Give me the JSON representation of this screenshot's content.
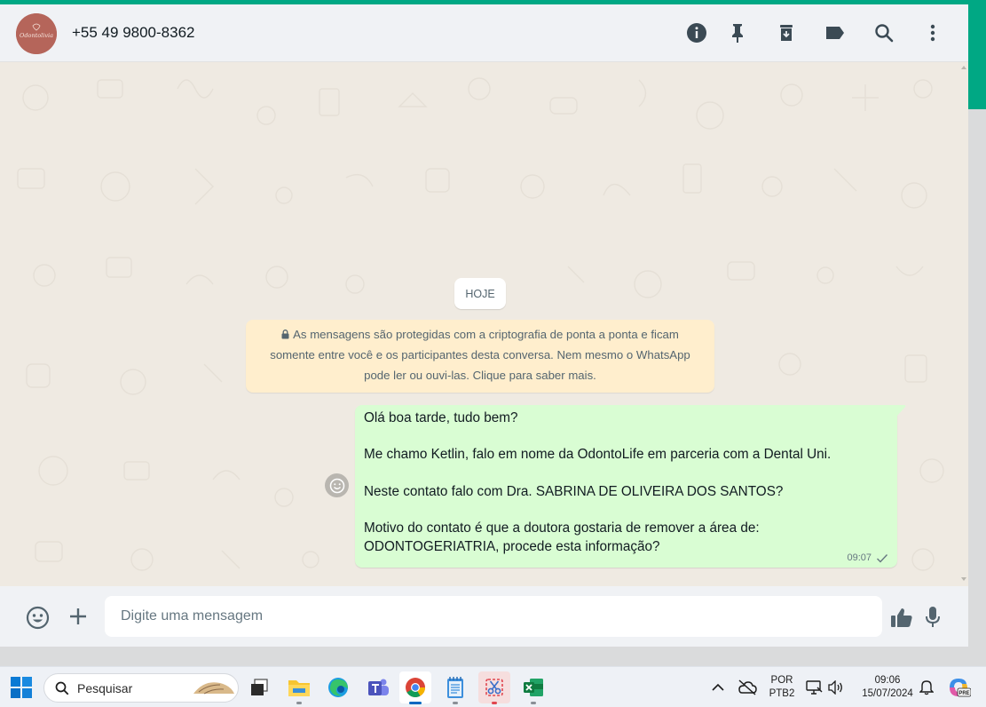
{
  "header": {
    "avatar_text": "Odontolivia",
    "contact_name": "+55 49 9800-8362"
  },
  "chat": {
    "date_chip": "HOJE",
    "encryption_notice": [
      "As mensagens são protegidas com a criptografia de ponta a ponta e ficam",
      "somente entre você e os participantes desta conversa. Nem mesmo o WhatsApp",
      "pode ler ou ouvi-las. Clique para saber mais."
    ],
    "message": {
      "lines": [
        "Olá boa tarde, tudo bem?",
        "",
        "Me chamo Ketlin, falo em nome da OdontoLife em parceria com a Dental Uni.",
        "",
        "Neste contato falo com Dra. SABRINA DE OLIVEIRA DOS SANTOS?",
        "",
        "Motivo do contato é que a doutora gostaria de remover a área de:",
        "ODONTOGERIATRIA, procede esta informação?"
      ],
      "time": "09:07",
      "status": "sent"
    }
  },
  "footer": {
    "input_placeholder": "Digite uma mensagem"
  },
  "taskbar": {
    "search_label": "Pesquisar",
    "language": "POR",
    "keyboard": "PTB2",
    "clock_time": "09:06",
    "clock_date": "15/07/2024",
    "copilot_badge": "PRE"
  },
  "colors": {
    "accent": "#00a884",
    "bubble_out": "#d9fdd3",
    "notice_bg": "#ffeecd",
    "chat_bg": "#efeae2"
  }
}
